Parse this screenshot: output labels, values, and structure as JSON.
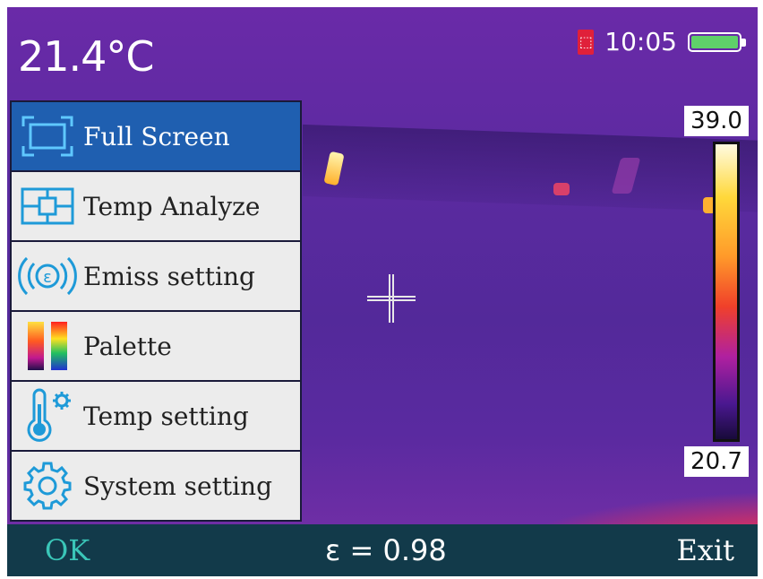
{
  "header": {
    "temperature": "21.4°C",
    "time": "10:05",
    "sd_icon": "sd-card-icon",
    "battery_icon": "battery-icon"
  },
  "menu": {
    "items": [
      {
        "label": "Full Screen",
        "icon": "full-screen-icon",
        "selected": true
      },
      {
        "label": "Temp Analyze",
        "icon": "temp-analyze-icon",
        "selected": false
      },
      {
        "label": "Emiss setting",
        "icon": "emissivity-icon",
        "selected": false
      },
      {
        "label": "Palette",
        "icon": "palette-icon",
        "selected": false
      },
      {
        "label": "Temp setting",
        "icon": "thermometer-gear-icon",
        "selected": false
      },
      {
        "label": "System setting",
        "icon": "gear-icon",
        "selected": false
      }
    ]
  },
  "colorbar": {
    "max": "39.0",
    "min": "20.7"
  },
  "footer": {
    "ok": "OK",
    "emissivity": "ε = 0.98",
    "exit": "Exit"
  },
  "colors": {
    "selected": "#1f5fb0",
    "icon_blue": "#1e9ad8",
    "footer_bg": "#123a4a",
    "ok_text": "#3ac6b8",
    "battery": "#5fd06a"
  }
}
